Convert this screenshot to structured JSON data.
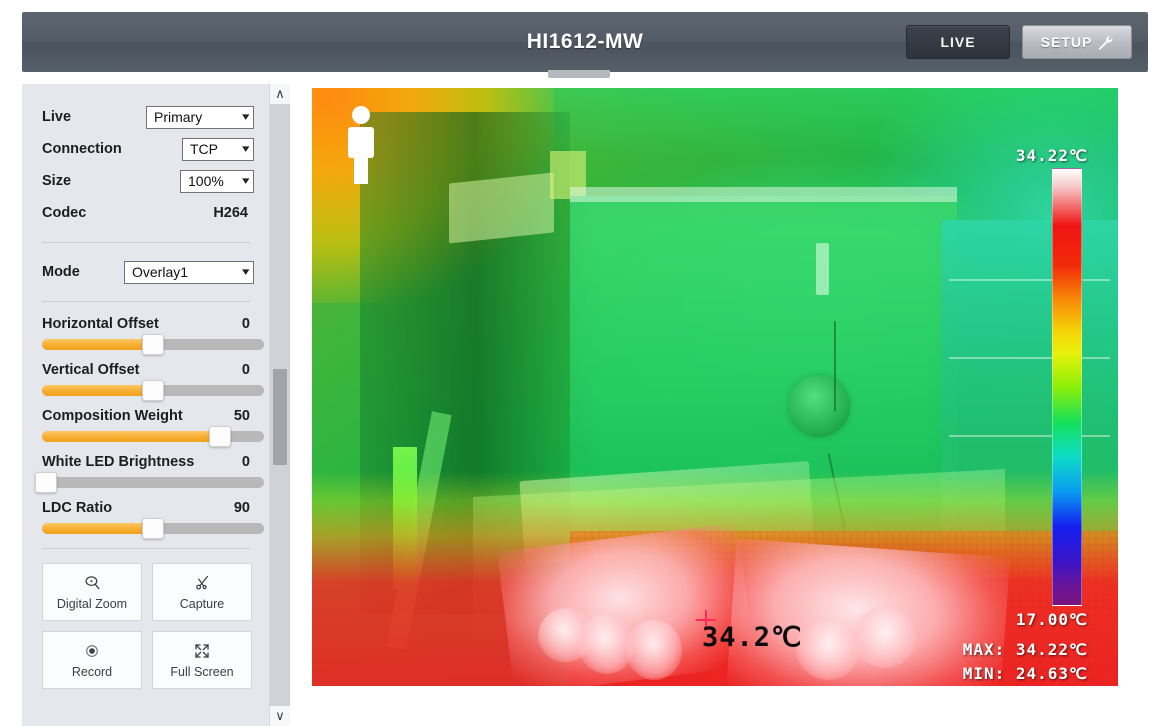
{
  "header": {
    "title": "HI1612-MW",
    "live_label": "LIVE",
    "setup_label": "SETUP"
  },
  "sidebar": {
    "rows": [
      {
        "label": "Live",
        "value": "Primary",
        "type": "select"
      },
      {
        "label": "Connection",
        "value": "TCP",
        "type": "select"
      },
      {
        "label": "Size",
        "value": "100%",
        "type": "select"
      },
      {
        "label": "Codec",
        "value": "H264",
        "type": "text"
      }
    ],
    "mode": {
      "label": "Mode",
      "value": "Overlay1"
    },
    "sliders": [
      {
        "label": "Horizontal Offset",
        "value": "0",
        "percent": 50
      },
      {
        "label": "Vertical Offset",
        "value": "0",
        "percent": 50
      },
      {
        "label": "Composition Weight",
        "value": "50",
        "percent": 80
      },
      {
        "label": "White LED Brightness",
        "value": "0",
        "percent": 1
      },
      {
        "label": "LDC Ratio",
        "value": "90",
        "percent": 50
      }
    ],
    "buttons": [
      {
        "label": "Digital Zoom",
        "icon": "magnifier-icon"
      },
      {
        "label": "Capture",
        "icon": "scissors-icon"
      },
      {
        "label": "Record",
        "icon": "record-dot-icon"
      },
      {
        "label": "Full Screen",
        "icon": "expand-arrows-icon"
      }
    ],
    "scrollbar": {
      "up": "∧",
      "down": "∨"
    }
  },
  "video": {
    "colorbar_max": "34.22℃",
    "colorbar_min": "17.00℃",
    "max_readout": "MAX: 34.22℃",
    "min_readout": "MIN: 24.63℃",
    "spot_temp": "34.2℃"
  },
  "colors": {
    "header_bg": "#525b66",
    "sidebar_bg": "#e4e8ec",
    "slider_fill": "#f7ae31",
    "live_btn": "#2d333b",
    "setup_btn": "#b9bcc1",
    "overlay_text": "#ffffff",
    "spot_marker": "#ff2b5a"
  }
}
